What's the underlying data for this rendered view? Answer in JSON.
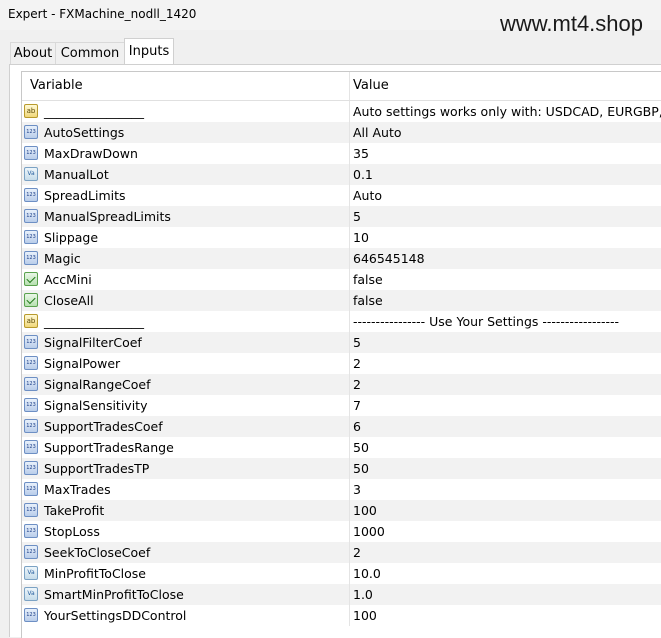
{
  "window": {
    "title": "Expert - FXMachine_nodll_1420"
  },
  "watermark": "www.mt4.shop",
  "tabs": [
    {
      "label": "About",
      "active": false
    },
    {
      "label": "Common",
      "active": false
    },
    {
      "label": "Inputs",
      "active": true
    }
  ],
  "grid": {
    "col_variable": "Variable",
    "col_value": "Value",
    "rows": [
      {
        "name": "________________",
        "value": "Auto settings works only with: USDCAD, EURGBP, GB...",
        "icon": "string-icon"
      },
      {
        "name": "AutoSettings",
        "value": "All Auto",
        "icon": "integer-icon"
      },
      {
        "name": "MaxDrawDown",
        "value": "35",
        "icon": "integer-icon"
      },
      {
        "name": "ManualLot",
        "value": "0.1",
        "icon": "double-icon"
      },
      {
        "name": "SpreadLimits",
        "value": "Auto",
        "icon": "integer-icon"
      },
      {
        "name": "ManualSpreadLimits",
        "value": "5",
        "icon": "integer-icon"
      },
      {
        "name": "Slippage",
        "value": "10",
        "icon": "integer-icon"
      },
      {
        "name": "Magic",
        "value": "646545148",
        "icon": "integer-icon"
      },
      {
        "name": "AccMini",
        "value": "false",
        "icon": "bool-icon"
      },
      {
        "name": "CloseAll",
        "value": "false",
        "icon": "bool-icon"
      },
      {
        "name": "________________",
        "value": "---------------- Use Your Settings -----------------",
        "icon": "string-icon"
      },
      {
        "name": "SignalFilterCoef",
        "value": "5",
        "icon": "integer-icon"
      },
      {
        "name": "SignalPower",
        "value": "2",
        "icon": "integer-icon"
      },
      {
        "name": "SignalRangeCoef",
        "value": "2",
        "icon": "integer-icon"
      },
      {
        "name": "SignalSensitivity",
        "value": "7",
        "icon": "integer-icon"
      },
      {
        "name": "SupportTradesCoef",
        "value": "6",
        "icon": "integer-icon"
      },
      {
        "name": "SupportTradesRange",
        "value": "50",
        "icon": "integer-icon"
      },
      {
        "name": "SupportTradesTP",
        "value": "50",
        "icon": "integer-icon"
      },
      {
        "name": "MaxTrades",
        "value": "3",
        "icon": "integer-icon"
      },
      {
        "name": "TakeProfit",
        "value": "100",
        "icon": "integer-icon"
      },
      {
        "name": "StopLoss",
        "value": "1000",
        "icon": "integer-icon"
      },
      {
        "name": "SeekToCloseCoef",
        "value": "2",
        "icon": "integer-icon"
      },
      {
        "name": "MinProfitToClose",
        "value": "10.0",
        "icon": "double-icon"
      },
      {
        "name": "SmartMinProfitToClose",
        "value": "1.0",
        "icon": "double-icon"
      },
      {
        "name": "YourSettingsDDControl",
        "value": "100",
        "icon": "integer-icon"
      }
    ]
  }
}
